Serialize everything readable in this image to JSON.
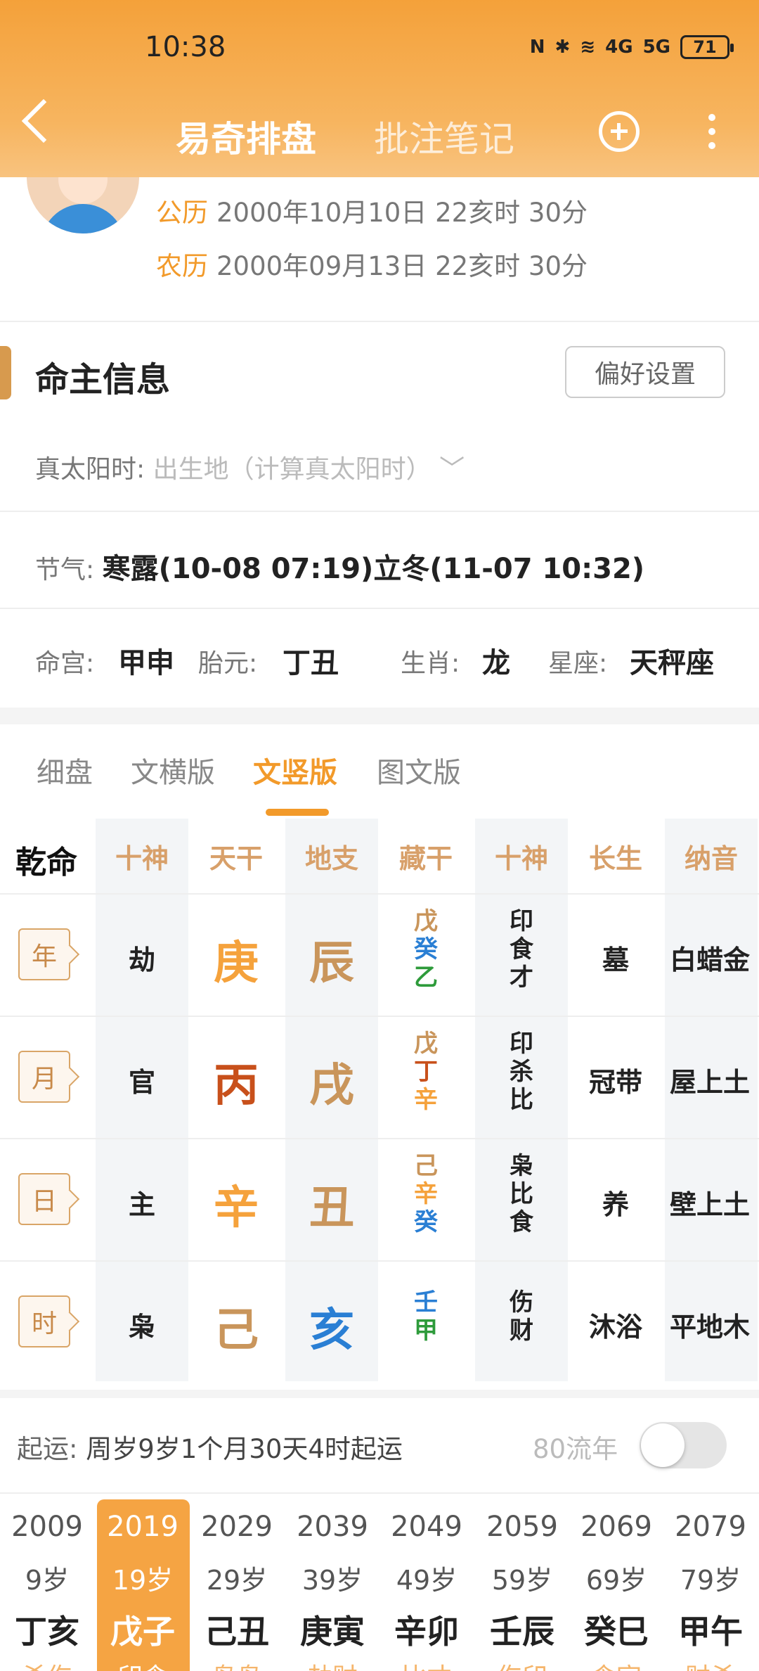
{
  "status_bar": {
    "time": "10:38",
    "signal1": "4G",
    "signal2": "5G",
    "battery": "71"
  },
  "nav": {
    "title_active": "易奇排盘",
    "title_inactive": "批注笔记"
  },
  "profile": {
    "solar_label": "公历",
    "solar_value": "2000年10月10日 22亥时 30分",
    "lunar_label": "农历",
    "lunar_value": "2000年09月13日 22亥时 30分"
  },
  "section": {
    "title": "命主信息",
    "pref_button": "偏好设置"
  },
  "true_solar": {
    "label": "真太阳时:",
    "placeholder": "出生地（计算真太阳时）"
  },
  "jieqi": {
    "label": "节气:",
    "value": "寒露(10-08 07:19)立冬(11-07 10:32)"
  },
  "extra": {
    "minggong_label": "命宫:",
    "minggong": "甲申",
    "taiyuan_label": "胎元:",
    "taiyuan": "丁丑",
    "shengxiao_label": "生肖:",
    "shengxiao": "龙",
    "xingzuo_label": "星座:",
    "xingzuo": "天秤座"
  },
  "tabs": [
    "细盘",
    "文横版",
    "文竖版",
    "图文版"
  ],
  "active_tab": "文竖版",
  "table": {
    "corner": "乾命",
    "headers": [
      "十神",
      "天干",
      "地支",
      "藏干",
      "十神",
      "长生",
      "纳音"
    ],
    "rows": [
      {
        "pillar": "年",
        "shishen": "劫",
        "gan": "庚",
        "zhi": "辰",
        "canggan": [
          "戊",
          "癸",
          "乙"
        ],
        "cang_shishen": [
          "印",
          "食",
          "才"
        ],
        "changsheng": "墓",
        "nayin": "白蜡金"
      },
      {
        "pillar": "月",
        "shishen": "官",
        "gan": "丙",
        "zhi": "戌",
        "canggan": [
          "戊",
          "丁",
          "辛"
        ],
        "cang_shishen": [
          "印",
          "杀",
          "比"
        ],
        "changsheng": "冠带",
        "nayin": "屋上土"
      },
      {
        "pillar": "日",
        "shishen": "主",
        "gan": "辛",
        "zhi": "丑",
        "canggan": [
          "己",
          "辛",
          "癸"
        ],
        "cang_shishen": [
          "枭",
          "比",
          "食"
        ],
        "changsheng": "养",
        "nayin": "壁上土"
      },
      {
        "pillar": "时",
        "shishen": "枭",
        "gan": "己",
        "zhi": "亥",
        "canggan": [
          "壬",
          "甲"
        ],
        "cang_shishen": [
          "伤",
          "财"
        ],
        "changsheng": "沐浴",
        "nayin": "平地木"
      }
    ]
  },
  "qiyun": {
    "label": "起运:",
    "value": "周岁9岁1个月30天4时起运",
    "liunian_label": "80流年"
  },
  "dayun": [
    {
      "year": "2009",
      "age": "9岁",
      "ganzhi": "丁亥",
      "shishen": "杀伤"
    },
    {
      "year": "2019",
      "age": "19岁",
      "ganzhi": "戊子",
      "shishen": "印食"
    },
    {
      "year": "2029",
      "age": "29岁",
      "ganzhi": "己丑",
      "shishen": "枭枭"
    },
    {
      "year": "2039",
      "age": "39岁",
      "ganzhi": "庚寅",
      "shishen": "劫财"
    },
    {
      "year": "2049",
      "age": "49岁",
      "ganzhi": "辛卯",
      "shishen": "比才"
    },
    {
      "year": "2059",
      "age": "59岁",
      "ganzhi": "壬辰",
      "shishen": "伤印"
    },
    {
      "year": "2069",
      "age": "69岁",
      "ganzhi": "癸巳",
      "shishen": "食官"
    },
    {
      "year": "2079",
      "age": "79岁",
      "ganzhi": "甲午",
      "shishen": "财杀"
    }
  ],
  "colors": {
    "accent": "#f29a2a",
    "header_top": "#f4a13a",
    "brown": "#c9955b",
    "blue": "#2a7fd4",
    "green": "#2e9b3b",
    "red": "#c8501b"
  }
}
